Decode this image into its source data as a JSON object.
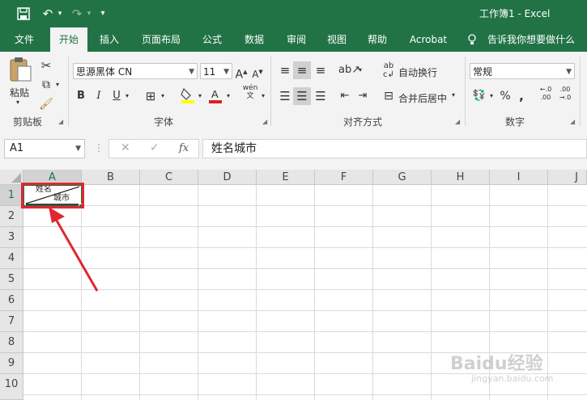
{
  "title_bar": {
    "title": "工作簿1  -  Excel"
  },
  "tabs": [
    "文件",
    "开始",
    "插入",
    "页面布局",
    "公式",
    "数据",
    "审阅",
    "视图",
    "帮助",
    "Acrobat"
  ],
  "tell_me": "告诉我你想要做什么",
  "clipboard": {
    "paste_label": "粘贴",
    "group_label": "剪贴板"
  },
  "font": {
    "font_name": "思源黑体 CN",
    "font_size": "11",
    "bold": "B",
    "italic": "I",
    "underline": "U",
    "group_label": "字体",
    "phonetic": "wén"
  },
  "alignment": {
    "wrap_text": "自动换行",
    "merge_center": "合并后居中",
    "group_label": "对齐方式"
  },
  "number": {
    "format": "常规",
    "percent": "%",
    "comma": ",",
    "inc_decimal": "←.0\n.00",
    "dec_decimal": ".00\n→.0",
    "group_label": "数字"
  },
  "formula_bar": {
    "name_box": "A1",
    "fx": "fx",
    "content": "姓名城市"
  },
  "columns": [
    "A",
    "B",
    "C",
    "D",
    "E",
    "F",
    "G",
    "H",
    "I",
    "J"
  ],
  "rows": [
    "1",
    "2",
    "3",
    "4",
    "5",
    "6",
    "7",
    "8",
    "9",
    "10"
  ],
  "cell_a1": {
    "top_text": "姓名",
    "bottom_text": "城市"
  },
  "watermark": {
    "text": "Baidu经验",
    "url": "jingyan.baidu.com"
  },
  "colors": {
    "excel_green": "#217346",
    "annotation_red": "#e0272f"
  }
}
